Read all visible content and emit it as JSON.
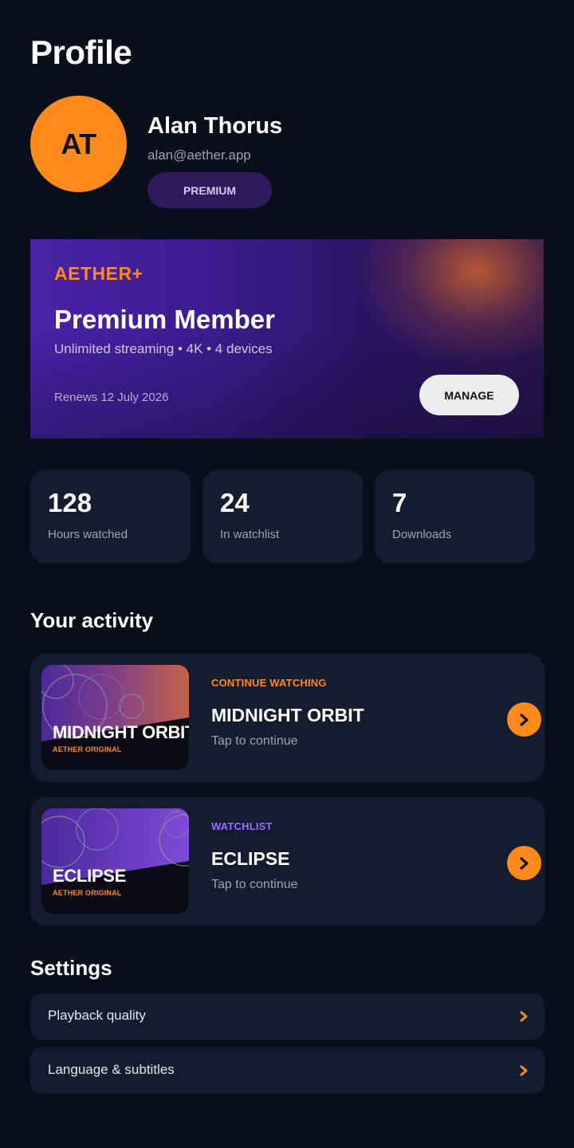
{
  "page": {
    "title": "Profile"
  },
  "user": {
    "initials": "AT",
    "name": "Alan Thorus",
    "email": "alan@aether.app",
    "plan_badge": "PREMIUM"
  },
  "membership": {
    "brand": "AETHER+",
    "title": "Premium Member",
    "features": "Unlimited streaming • 4K • 4 devices",
    "renewal": "Renews 12 July 2026",
    "manage_label": "MANAGE"
  },
  "stats": [
    {
      "value": "128",
      "label": "Hours watched"
    },
    {
      "value": "24",
      "label": "In watchlist"
    },
    {
      "value": "7",
      "label": "Downloads"
    }
  ],
  "activity": {
    "heading": "Your activity",
    "items": [
      {
        "status": "CONTINUE WATCHING",
        "status_color": "#ff8a1c",
        "title": "MIDNIGHT ORBIT",
        "thumb_title": "MIDNIGHT ORBIT",
        "thumb_subtitle": "AETHER ORIGINAL",
        "subtitle": "Tap to continue",
        "icon": "chevron-right-icon"
      },
      {
        "status": "WATCHLIST",
        "status_color": "#9b6bff",
        "title": "ECLIPSE",
        "thumb_title": "ECLIPSE",
        "thumb_subtitle": "AETHER ORIGINAL",
        "subtitle": "Tap to continue",
        "icon": "chevron-right-icon"
      }
    ]
  },
  "settings": {
    "heading": "Settings",
    "items": [
      {
        "label": "Playback quality",
        "icon": "chevron-right-icon"
      },
      {
        "label": "Language & subtitles",
        "icon": "chevron-right-icon"
      }
    ]
  },
  "colors": {
    "background": "#0a0e1a",
    "card": "#141c2f",
    "accent": "#ff8a1c",
    "purple": "#9b6bff",
    "badge_bg": "#2e1c5a"
  }
}
